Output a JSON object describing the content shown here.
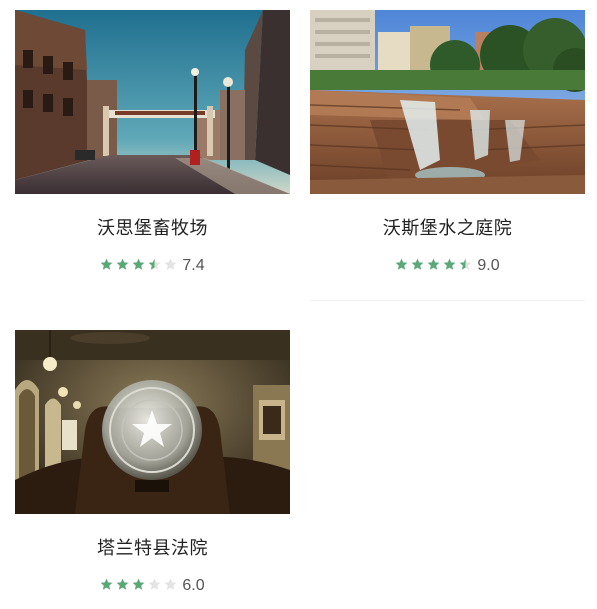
{
  "colors": {
    "star_on": "#5aa878",
    "star_off": "#e3e3e3"
  },
  "attractions": [
    {
      "name": "沃思堡畜牧场",
      "score": "7.4",
      "stars": 3.5
    },
    {
      "name": "沃斯堡水之庭院",
      "score": "9.0",
      "stars": 4.5
    },
    {
      "name": "塔兰特县法院",
      "score": "6.0",
      "stars": 3
    }
  ]
}
